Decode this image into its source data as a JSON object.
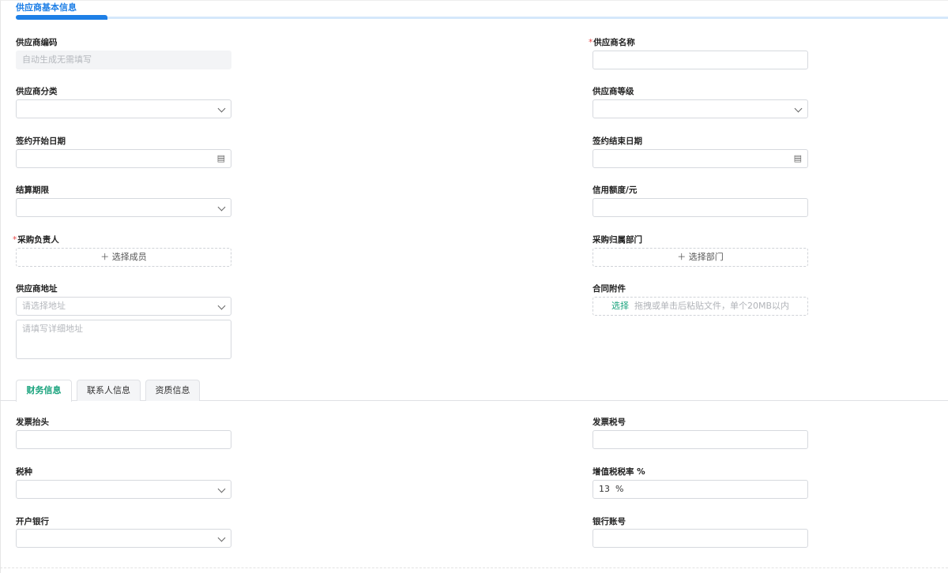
{
  "section_title": "供应商基本信息",
  "fields": {
    "code": {
      "label": "供应商编码",
      "placeholder": "自动生成无需填写"
    },
    "name": {
      "label": "供应商名称",
      "required": "*"
    },
    "category": {
      "label": "供应商分类"
    },
    "level": {
      "label": "供应商等级"
    },
    "start_date": {
      "label": "签约开始日期"
    },
    "end_date": {
      "label": "签约结束日期"
    },
    "settle": {
      "label": "结算期限"
    },
    "credit": {
      "label": "信用额度/元"
    },
    "buyer": {
      "label": "采购负责人",
      "required": "*",
      "button": "＋ 选择成员"
    },
    "dept": {
      "label": "采购归属部门",
      "button": "＋ 选择部门"
    },
    "address": {
      "label": "供应商地址",
      "placeholder": "请选择地址",
      "detail_placeholder": "请填写详细地址"
    },
    "attach": {
      "label": "合同附件",
      "select": "选择",
      "hint": "拖拽或单击后粘贴文件，单个20MB以内"
    }
  },
  "tabs": [
    "财务信息",
    "联系人信息",
    "资质信息"
  ],
  "finance": {
    "invoice_title": {
      "label": "发票抬头"
    },
    "tax_no": {
      "label": "发票税号"
    },
    "tax_type": {
      "label": "税种"
    },
    "vat_rate": {
      "label": "增值税税率 %",
      "value": "13  %"
    },
    "bank": {
      "label": "开户银行"
    },
    "account": {
      "label": "银行账号"
    }
  }
}
